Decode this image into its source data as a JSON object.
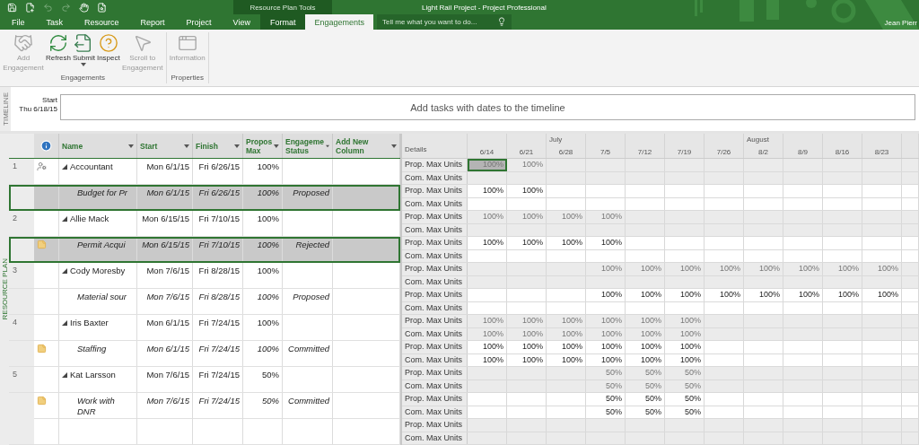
{
  "window": {
    "title": "Light Rail Project - Project Professional",
    "context_group": "Resource Plan Tools",
    "user": "Jean Pierr"
  },
  "tabs": [
    {
      "label": "File",
      "selected": false,
      "contextual": false
    },
    {
      "label": "Task",
      "selected": false,
      "contextual": false
    },
    {
      "label": "Resource",
      "selected": false,
      "contextual": false
    },
    {
      "label": "Report",
      "selected": false,
      "contextual": false
    },
    {
      "label": "Project",
      "selected": false,
      "contextual": false
    },
    {
      "label": "View",
      "selected": false,
      "contextual": false
    },
    {
      "label": "Format",
      "selected": false,
      "contextual": true
    },
    {
      "label": "Engagements",
      "selected": true,
      "contextual": true
    }
  ],
  "tell_me": {
    "placeholder": "Tell me what you want to do..."
  },
  "ribbon": [
    {
      "label": "Engagements",
      "buttons": [
        {
          "label": "Add Engagement",
          "kind": "handshake",
          "disabled": true,
          "dropdown": false
        },
        {
          "label": "Refresh",
          "kind": "refresh",
          "disabled": false,
          "dropdown": false
        },
        {
          "label": "Submit",
          "kind": "submit",
          "disabled": false,
          "dropdown": true
        },
        {
          "label": "Inspect",
          "kind": "inspect",
          "disabled": false,
          "dropdown": false
        },
        {
          "label": "Scroll to Engagement",
          "kind": "scroll",
          "disabled": true,
          "dropdown": false
        }
      ]
    },
    {
      "label": "Properties",
      "buttons": [
        {
          "label": "Information",
          "kind": "information",
          "disabled": true,
          "dropdown": false
        }
      ]
    }
  ],
  "timeline": {
    "label": "TIMELINE",
    "start_label": "Start",
    "start_date": "Thu 6/18/15",
    "placeholder": "Add tasks with dates to the timeline"
  },
  "view_label": "RESOURCE PLAN",
  "table": {
    "columns": [
      {
        "label": "Name",
        "filter": true
      },
      {
        "label": "Start",
        "filter": true
      },
      {
        "label": "Finish",
        "filter": true
      },
      {
        "label": "Propos Max",
        "filter": true
      },
      {
        "label": "Engageme Status",
        "filter": true
      },
      {
        "label": "Add New Column",
        "filter": true
      }
    ],
    "rows": [
      {
        "kind": "resource",
        "id": "1",
        "indicator": {
          "kind": "person"
        },
        "name": "Accountant",
        "start": "Mon 6/1/15",
        "finish": "Fri 6/26/15",
        "units": "100%",
        "expanded": true,
        "selected": false
      },
      {
        "kind": "assignment",
        "name": "Budget for Pr",
        "start": "Mon 6/1/15",
        "finish": "Fri 6/26/15",
        "units": "100%",
        "status": "Proposed",
        "selected": true
      },
      {
        "kind": "resource",
        "id": "2",
        "name": "Allie Mack",
        "start": "Mon 6/15/15",
        "finish": "Fri 7/10/15",
        "units": "100%",
        "expanded": true,
        "selected": false
      },
      {
        "kind": "assignment",
        "indicator": {
          "kind": "note"
        },
        "name": "Permit Acqui",
        "start": "Mon 6/15/15",
        "finish": "Fri 7/10/15",
        "units": "100%",
        "status": "Rejected",
        "selected": true
      },
      {
        "kind": "resource",
        "id": "3",
        "name": "Cody Moresby",
        "start": "Mon 7/6/15",
        "finish": "Fri 8/28/15",
        "units": "100%",
        "expanded": true,
        "selected": false
      },
      {
        "kind": "assignment",
        "name": "Material sour",
        "start": "Mon 7/6/15",
        "finish": "Fri 8/28/15",
        "units": "100%",
        "status": "Proposed",
        "selected": false
      },
      {
        "kind": "resource",
        "id": "4",
        "name": "Iris Baxter",
        "start": "Mon 6/1/15",
        "finish": "Fri 7/24/15",
        "units": "100%",
        "expanded": true,
        "selected": false
      },
      {
        "kind": "assignment",
        "indicator": {
          "kind": "note"
        },
        "name": "Staffing",
        "start": "Mon 6/1/15",
        "finish": "Fri 7/24/15",
        "units": "100%",
        "status": "Committed",
        "selected": false
      },
      {
        "kind": "resource",
        "id": "5",
        "name": "Kat Larsson",
        "start": "Mon 7/6/15",
        "finish": "Fri 7/24/15",
        "units": "50%",
        "expanded": true,
        "selected": false
      },
      {
        "kind": "assignment",
        "indicator": {
          "kind": "note"
        },
        "name": "Work with DNR",
        "start": "Mon 7/6/15",
        "finish": "Fri 7/24/15",
        "units": "50%",
        "status": "Committed",
        "selected": false
      }
    ]
  },
  "timephased": {
    "details_heading": "Details",
    "weeks": [
      {
        "label": "6/14"
      },
      {
        "label": "6/21"
      },
      {
        "label": "6/28",
        "month": "July"
      },
      {
        "label": "7/5"
      },
      {
        "label": "7/12"
      },
      {
        "label": "7/19"
      },
      {
        "label": "7/26"
      },
      {
        "label": "8/2",
        "month": "August"
      },
      {
        "label": "8/9"
      },
      {
        "label": "8/16"
      },
      {
        "label": "8/23"
      }
    ],
    "rows": [
      {
        "kind": "resource",
        "lines": [
          {
            "label": "Prop. Max Units",
            "selected": true,
            "cells": [
              "100%",
              "100%",
              null,
              null,
              null,
              null,
              null,
              null,
              null,
              null,
              null
            ]
          },
          {
            "label": "Com. Max Units",
            "selected": false,
            "cells": [
              null,
              null,
              null,
              null,
              null,
              null,
              null,
              null,
              null,
              null,
              null
            ]
          }
        ]
      },
      {
        "kind": "assignment",
        "lines": [
          {
            "label": "Prop. Max Units",
            "selected": false,
            "cells": [
              "100%",
              "100%",
              null,
              null,
              null,
              null,
              null,
              null,
              null,
              null,
              null
            ]
          },
          {
            "label": "Com. Max Units",
            "selected": false,
            "cells": [
              null,
              null,
              null,
              null,
              null,
              null,
              null,
              null,
              null,
              null,
              null
            ]
          }
        ]
      },
      {
        "kind": "resource",
        "lines": [
          {
            "label": "Prop. Max Units",
            "selected": false,
            "cells": [
              "100%",
              "100%",
              "100%",
              "100%",
              null,
              null,
              null,
              null,
              null,
              null,
              null
            ]
          },
          {
            "label": "Com. Max Units",
            "selected": false,
            "cells": [
              null,
              null,
              null,
              null,
              null,
              null,
              null,
              null,
              null,
              null,
              null
            ]
          }
        ]
      },
      {
        "kind": "assignment",
        "lines": [
          {
            "label": "Prop. Max Units",
            "selected": false,
            "cells": [
              "100%",
              "100%",
              "100%",
              "100%",
              null,
              null,
              null,
              null,
              null,
              null,
              null
            ]
          },
          {
            "label": "Com. Max Units",
            "selected": false,
            "cells": [
              null,
              null,
              null,
              null,
              null,
              null,
              null,
              null,
              null,
              null,
              null
            ]
          }
        ]
      },
      {
        "kind": "resource",
        "lines": [
          {
            "label": "Prop. Max Units",
            "selected": false,
            "cells": [
              null,
              null,
              null,
              "100%",
              "100%",
              "100%",
              "100%",
              "100%",
              "100%",
              "100%",
              "100%"
            ]
          },
          {
            "label": "Com. Max Units",
            "selected": false,
            "cells": [
              null,
              null,
              null,
              null,
              null,
              null,
              null,
              null,
              null,
              null,
              null
            ]
          }
        ]
      },
      {
        "kind": "assignment",
        "lines": [
          {
            "label": "Prop. Max Units",
            "selected": false,
            "cells": [
              null,
              null,
              null,
              "100%",
              "100%",
              "100%",
              "100%",
              "100%",
              "100%",
              "100%",
              "100%"
            ]
          },
          {
            "label": "Com. Max Units",
            "selected": false,
            "cells": [
              null,
              null,
              null,
              null,
              null,
              null,
              null,
              null,
              null,
              null,
              null
            ]
          }
        ]
      },
      {
        "kind": "resource",
        "lines": [
          {
            "label": "Prop. Max Units",
            "selected": false,
            "cells": [
              "100%",
              "100%",
              "100%",
              "100%",
              "100%",
              "100%",
              null,
              null,
              null,
              null,
              null
            ]
          },
          {
            "label": "Com. Max Units",
            "selected": false,
            "cells": [
              "100%",
              "100%",
              "100%",
              "100%",
              "100%",
              "100%",
              null,
              null,
              null,
              null,
              null
            ]
          }
        ]
      },
      {
        "kind": "assignment",
        "lines": [
          {
            "label": "Prop. Max Units",
            "selected": false,
            "cells": [
              "100%",
              "100%",
              "100%",
              "100%",
              "100%",
              "100%",
              null,
              null,
              null,
              null,
              null
            ]
          },
          {
            "label": "Com. Max Units",
            "selected": false,
            "cells": [
              "100%",
              "100%",
              "100%",
              "100%",
              "100%",
              "100%",
              null,
              null,
              null,
              null,
              null
            ]
          }
        ]
      },
      {
        "kind": "resource",
        "lines": [
          {
            "label": "Prop. Max Units",
            "selected": false,
            "cells": [
              null,
              null,
              null,
              "50%",
              "50%",
              "50%",
              null,
              null,
              null,
              null,
              null
            ]
          },
          {
            "label": "Com. Max Units",
            "selected": false,
            "cells": [
              null,
              null,
              null,
              "50%",
              "50%",
              "50%",
              null,
              null,
              null,
              null,
              null
            ]
          }
        ]
      },
      {
        "kind": "assignment",
        "lines": [
          {
            "label": "Prop. Max Units",
            "selected": false,
            "cells": [
              null,
              null,
              null,
              "50%",
              "50%",
              "50%",
              null,
              null,
              null,
              null,
              null
            ]
          },
          {
            "label": "Com. Max Units",
            "selected": false,
            "cells": [
              null,
              null,
              null,
              "50%",
              "50%",
              "50%",
              null,
              null,
              null,
              null,
              null
            ]
          }
        ]
      },
      {
        "kind": "resource",
        "lines": [
          {
            "label": "Prop. Max Units",
            "selected": false,
            "cells": [
              null,
              null,
              null,
              null,
              null,
              null,
              null,
              null,
              null,
              null,
              null
            ]
          },
          {
            "label": "Com. Max Units",
            "selected": false,
            "cells": [
              null,
              null,
              null,
              null,
              null,
              null,
              null,
              null,
              null,
              null,
              null
            ]
          }
        ]
      }
    ]
  }
}
